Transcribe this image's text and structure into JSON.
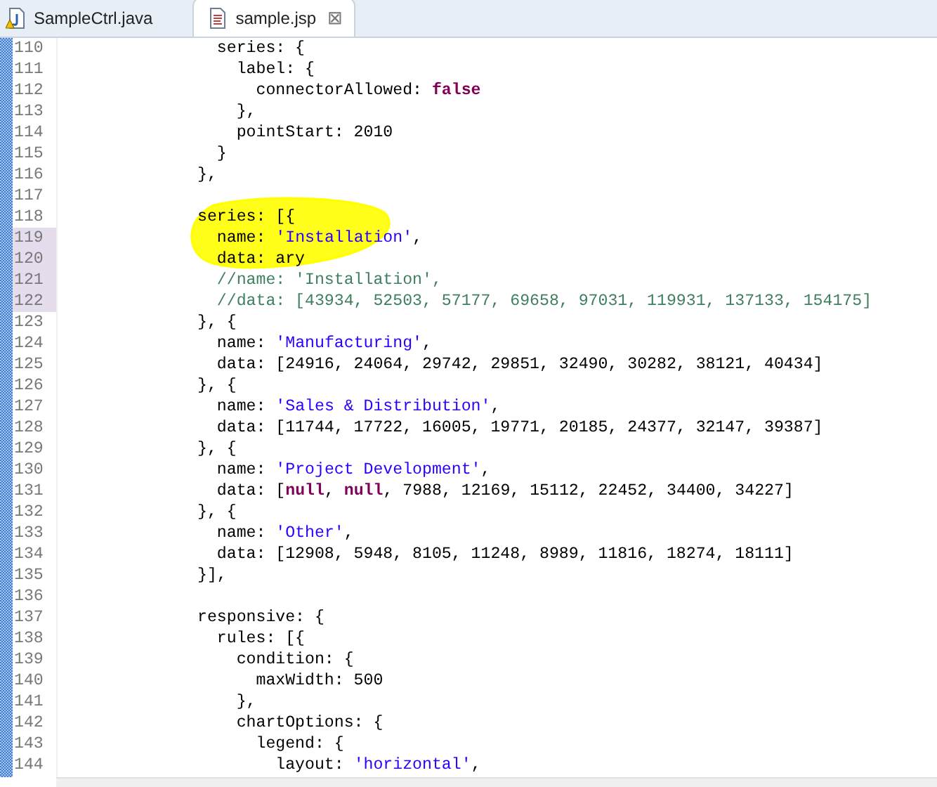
{
  "tabs": [
    {
      "label": "SampleCtrl.java",
      "kind": "java",
      "selected": false,
      "closable": false
    },
    {
      "label": "sample.jsp",
      "kind": "jsp",
      "selected": true,
      "closable": true
    }
  ],
  "close_glyph": "⊠",
  "lines": [
    {
      "number": "110",
      "highlighted": false,
      "tokens": [
        {
          "kind": "plain",
          "text": "              series: {"
        }
      ]
    },
    {
      "number": "111",
      "highlighted": false,
      "tokens": [
        {
          "kind": "plain",
          "text": "                label: {"
        }
      ]
    },
    {
      "number": "112",
      "highlighted": false,
      "tokens": [
        {
          "kind": "plain",
          "text": "                  connectorAllowed: "
        },
        {
          "kind": "keyword",
          "text": "false"
        }
      ]
    },
    {
      "number": "113",
      "highlighted": false,
      "tokens": [
        {
          "kind": "plain",
          "text": "                },"
        }
      ]
    },
    {
      "number": "114",
      "highlighted": false,
      "tokens": [
        {
          "kind": "plain",
          "text": "                pointStart: 2010"
        }
      ]
    },
    {
      "number": "115",
      "highlighted": false,
      "tokens": [
        {
          "kind": "plain",
          "text": "              }"
        }
      ]
    },
    {
      "number": "116",
      "highlighted": false,
      "tokens": [
        {
          "kind": "plain",
          "text": "            },"
        }
      ]
    },
    {
      "number": "117",
      "highlighted": false
    },
    {
      "number": "118",
      "highlighted": false,
      "tokens": [
        {
          "kind": "plain",
          "text": "            series: [{"
        }
      ]
    },
    {
      "number": "119",
      "highlighted": true,
      "tokens": [
        {
          "kind": "plain",
          "text": "              name: "
        },
        {
          "kind": "string",
          "text": "'Installation'"
        },
        {
          "kind": "plain",
          "text": ","
        }
      ]
    },
    {
      "number": "120",
      "highlighted": true,
      "tokens": [
        {
          "kind": "plain",
          "text": "              data: ary"
        }
      ]
    },
    {
      "number": "121",
      "highlighted": true,
      "tokens": [
        {
          "kind": "comment",
          "text": "              //name: 'Installation',"
        }
      ]
    },
    {
      "number": "122",
      "highlighted": true,
      "tokens": [
        {
          "kind": "comment",
          "text": "              //data: [43934, 52503, 57177, 69658, 97031, 119931, 137133, 154175]"
        }
      ]
    },
    {
      "number": "123",
      "highlighted": false,
      "tokens": [
        {
          "kind": "plain",
          "text": "            }, {"
        }
      ]
    },
    {
      "number": "124",
      "highlighted": false,
      "tokens": [
        {
          "kind": "plain",
          "text": "              name: "
        },
        {
          "kind": "string",
          "text": "'Manufacturing'"
        },
        {
          "kind": "plain",
          "text": ","
        }
      ]
    },
    {
      "number": "125",
      "highlighted": false,
      "tokens": [
        {
          "kind": "plain",
          "text": "              data: [24916, 24064, 29742, 29851, 32490, 30282, 38121, 40434]"
        }
      ]
    },
    {
      "number": "126",
      "highlighted": false,
      "tokens": [
        {
          "kind": "plain",
          "text": "            }, {"
        }
      ]
    },
    {
      "number": "127",
      "highlighted": false,
      "tokens": [
        {
          "kind": "plain",
          "text": "              name: "
        },
        {
          "kind": "string",
          "text": "'Sales & Distribution'"
        },
        {
          "kind": "plain",
          "text": ","
        }
      ]
    },
    {
      "number": "128",
      "highlighted": false,
      "tokens": [
        {
          "kind": "plain",
          "text": "              data: [11744, 17722, 16005, 19771, 20185, 24377, 32147, 39387]"
        }
      ]
    },
    {
      "number": "129",
      "highlighted": false,
      "tokens": [
        {
          "kind": "plain",
          "text": "            }, {"
        }
      ]
    },
    {
      "number": "130",
      "highlighted": false,
      "tokens": [
        {
          "kind": "plain",
          "text": "              name: "
        },
        {
          "kind": "string",
          "text": "'Project Development'"
        },
        {
          "kind": "plain",
          "text": ","
        }
      ]
    },
    {
      "number": "131",
      "highlighted": false,
      "tokens": [
        {
          "kind": "plain",
          "text": "              data: ["
        },
        {
          "kind": "keyword",
          "text": "null"
        },
        {
          "kind": "plain",
          "text": ", "
        },
        {
          "kind": "keyword",
          "text": "null"
        },
        {
          "kind": "plain",
          "text": ", 7988, 12169, 15112, 22452, 34400, 34227]"
        }
      ]
    },
    {
      "number": "132",
      "highlighted": false,
      "tokens": [
        {
          "kind": "plain",
          "text": "            }, {"
        }
      ]
    },
    {
      "number": "133",
      "highlighted": false,
      "tokens": [
        {
          "kind": "plain",
          "text": "              name: "
        },
        {
          "kind": "string",
          "text": "'Other'"
        },
        {
          "kind": "plain",
          "text": ","
        }
      ]
    },
    {
      "number": "134",
      "highlighted": false,
      "tokens": [
        {
          "kind": "plain",
          "text": "              data: [12908, 5948, 8105, 11248, 8989, 11816, 18274, 18111]"
        }
      ]
    },
    {
      "number": "135",
      "highlighted": false,
      "tokens": [
        {
          "kind": "plain",
          "text": "            }],"
        }
      ]
    },
    {
      "number": "136",
      "highlighted": false
    },
    {
      "number": "137",
      "highlighted": false,
      "tokens": [
        {
          "kind": "plain",
          "text": "            responsive: {"
        }
      ]
    },
    {
      "number": "138",
      "highlighted": false,
      "tokens": [
        {
          "kind": "plain",
          "text": "              rules: [{"
        }
      ]
    },
    {
      "number": "139",
      "highlighted": false,
      "tokens": [
        {
          "kind": "plain",
          "text": "                condition: {"
        }
      ]
    },
    {
      "number": "140",
      "highlighted": false,
      "tokens": [
        {
          "kind": "plain",
          "text": "                  maxWidth: 500"
        }
      ]
    },
    {
      "number": "141",
      "highlighted": false,
      "tokens": [
        {
          "kind": "plain",
          "text": "                },"
        }
      ]
    },
    {
      "number": "142",
      "highlighted": false,
      "tokens": [
        {
          "kind": "plain",
          "text": "                chartOptions: {"
        }
      ]
    },
    {
      "number": "143",
      "highlighted": false,
      "tokens": [
        {
          "kind": "plain",
          "text": "                  legend: {"
        }
      ]
    },
    {
      "number": "144",
      "highlighted": false,
      "tokens": [
        {
          "kind": "plain",
          "text": "                    layout: "
        },
        {
          "kind": "string",
          "text": "'horizontal'"
        },
        {
          "kind": "plain",
          "text": ","
        }
      ]
    }
  ]
}
